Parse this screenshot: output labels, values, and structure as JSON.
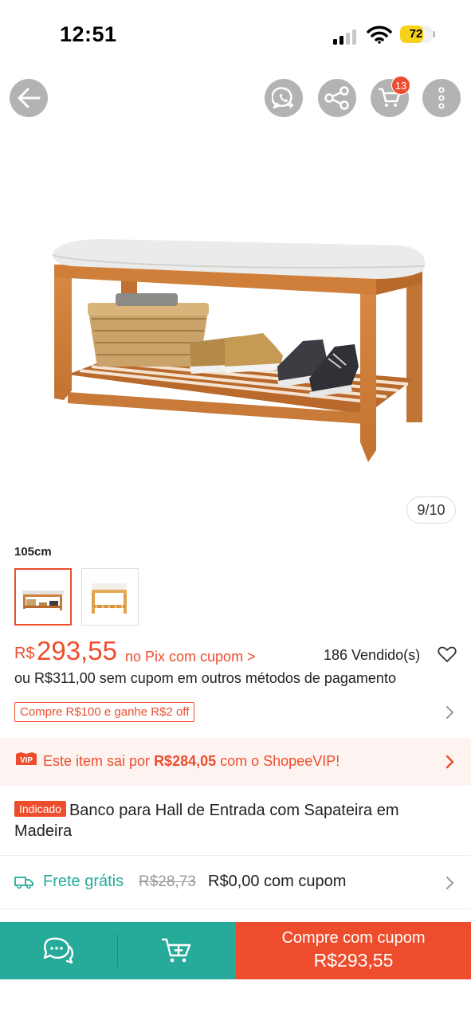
{
  "status_bar": {
    "time": "12:51",
    "battery": "72",
    "battery_level": 0.72,
    "battery_color": "#f7d21a"
  },
  "header": {
    "icons": [
      "back-arrow-icon",
      "whatsapp-share-icon",
      "share-icon",
      "cart-icon",
      "more-options-icon"
    ],
    "cart_count": "13"
  },
  "gallery": {
    "counter": "9/10",
    "variant_label": "105cm",
    "thumbnails": [
      "bench-with-shoes",
      "bench-empty"
    ],
    "selected_thumbnail": 0
  },
  "price": {
    "currency": "R$",
    "value": "293,55",
    "pix_text": "no Pix com cupom >",
    "sold": "186 Vendido(s)",
    "alternative": "ou R$311,00 sem cupom em outros métodos de pagamento"
  },
  "promo": {
    "tag": "Compre R$100 e ganhe R$2 off"
  },
  "vip": {
    "badge": "VIP",
    "text_before": "Este item sai por ",
    "amount": "R$284,05",
    "text_after": " com o ShopeeVIP!"
  },
  "product": {
    "badge": "Indicado",
    "title": "Banco para Hall de Entrada com Sapateira em Madeira"
  },
  "shipping": {
    "label": "Frete grátis",
    "old_price": "R$28,73",
    "new_price": "R$0,00 com cupom"
  },
  "bottom_bar": {
    "buy_label": "Compre com cupom",
    "buy_price": "R$293,55"
  },
  "colors": {
    "accent": "#ee4d2d",
    "teal": "#26aa99",
    "vip_background": "#fdf4f1"
  }
}
